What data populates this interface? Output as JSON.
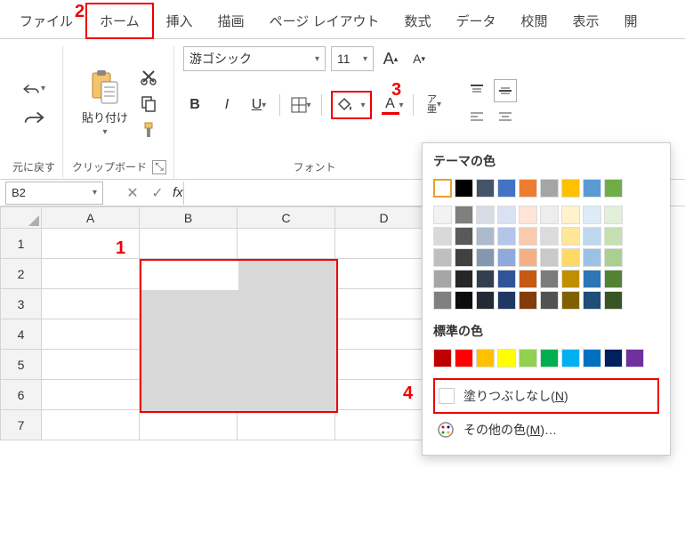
{
  "tabs": {
    "file": "ファイル",
    "home": "ホーム",
    "insert": "挿入",
    "draw": "描画",
    "layout": "ページ レイアウト",
    "formula": "数式",
    "data": "データ",
    "review": "校閲",
    "view": "表示",
    "dev": "開"
  },
  "ribbon": {
    "undo_label": "元に戻す",
    "clipboard_label": "クリップボード",
    "paste_label": "貼り付け",
    "font_label": "フォント",
    "font_name": "游ゴシック",
    "font_size": "11"
  },
  "colorpanel": {
    "theme_title": "テーマの色",
    "standard_title": "標準の色",
    "nofill_label": "塗りつぶしなし(N)",
    "more_label": "その他の色(M)…",
    "theme_row1": [
      "#ffffff",
      "#000000",
      "#44546a",
      "#4472c4",
      "#ed7d31",
      "#a5a5a5",
      "#ffc000",
      "#5b9bd5",
      "#70ad47"
    ],
    "theme_matrix": [
      [
        "#f2f2f2",
        "#7f7f7f",
        "#d6dce4",
        "#d9e1f2",
        "#fce4d6",
        "#ededed",
        "#fff2cc",
        "#ddebf7",
        "#e2efda"
      ],
      [
        "#d9d9d9",
        "#595959",
        "#acb9ca",
        "#b4c6e7",
        "#f8cbad",
        "#dbdbdb",
        "#ffe699",
        "#bdd7ee",
        "#c6e0b4"
      ],
      [
        "#bfbfbf",
        "#404040",
        "#8497b0",
        "#8ea9db",
        "#f4b084",
        "#c9c9c9",
        "#ffd966",
        "#9bc2e6",
        "#a9d08e"
      ],
      [
        "#a6a6a6",
        "#262626",
        "#333f4f",
        "#305496",
        "#c65911",
        "#7b7b7b",
        "#bf8f00",
        "#2f75b5",
        "#548235"
      ],
      [
        "#808080",
        "#0d0d0d",
        "#222b35",
        "#203764",
        "#833c0c",
        "#525252",
        "#806000",
        "#1f4e78",
        "#375623"
      ]
    ],
    "standard_row": [
      "#c00000",
      "#ff0000",
      "#ffc000",
      "#ffff00",
      "#92d050",
      "#00b050",
      "#00b0f0",
      "#0070c0",
      "#002060",
      "#7030a0"
    ]
  },
  "namebox": "B2",
  "cols": [
    "A",
    "B",
    "C",
    "D"
  ],
  "rows": [
    "1",
    "2",
    "3",
    "4",
    "5",
    "6",
    "7"
  ],
  "callouts": {
    "c1": "1",
    "c2": "2",
    "c3": "3",
    "c4": "4"
  },
  "underline_key": "N",
  "underline_key2": "M"
}
